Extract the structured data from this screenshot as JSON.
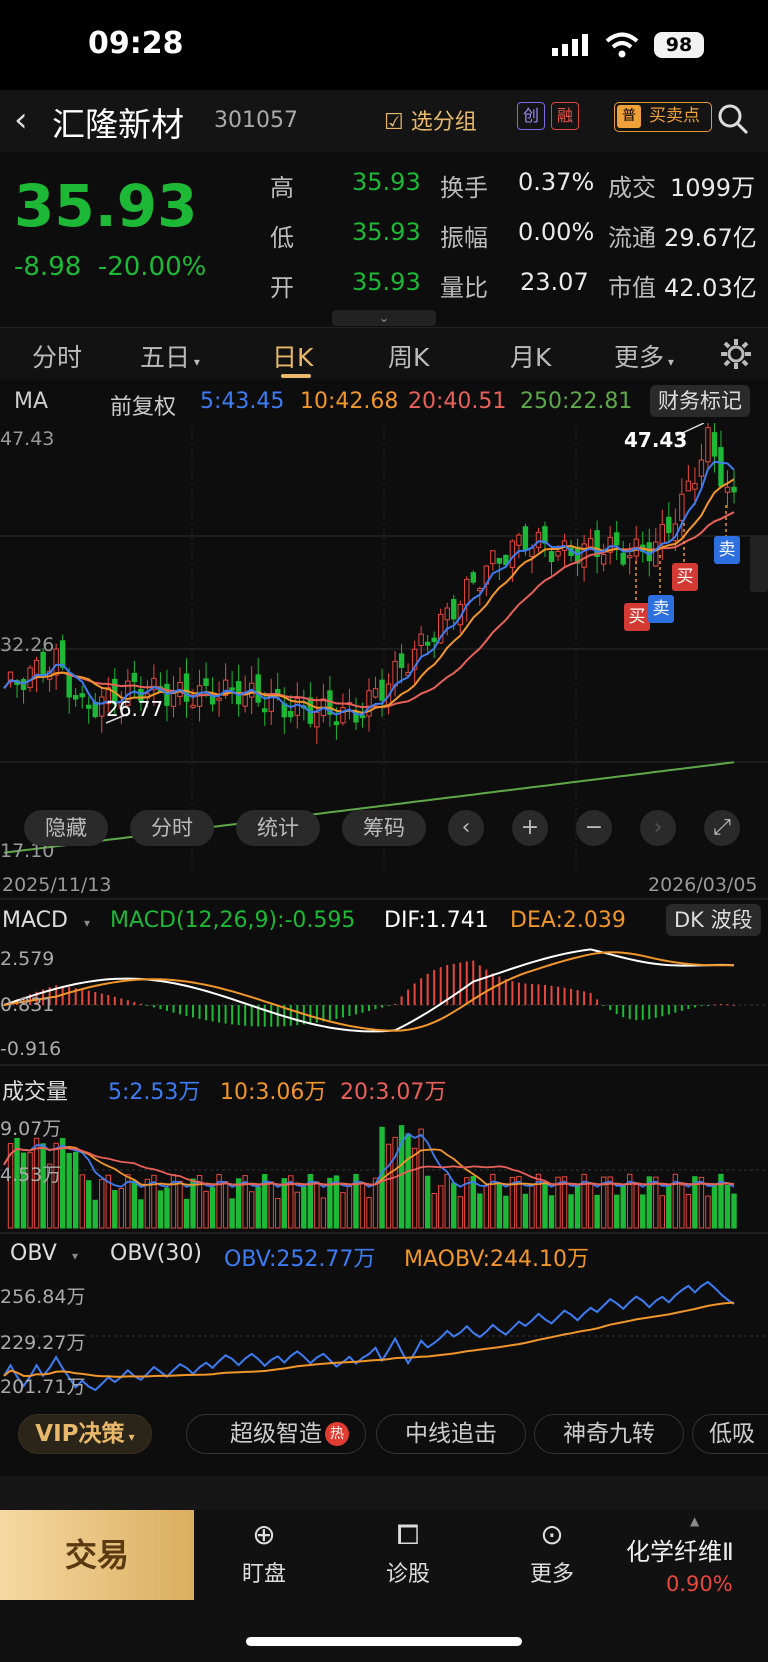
{
  "status": {
    "time": "09:28",
    "battery": "98"
  },
  "header": {
    "name": "汇隆新材",
    "code": "301057",
    "group_btn": "选分组",
    "tag_chuang": "创",
    "tag_rong": "融",
    "tag_pu": "普",
    "buysell_label": "买卖点"
  },
  "quote": {
    "price": "35.93",
    "change": "-8.98",
    "change_pct": "-20.00%",
    "rows": [
      {
        "l1": "高",
        "v1": "35.93",
        "l2": "换手",
        "v2": "0.37%",
        "l3": "成交",
        "v3": "1099万"
      },
      {
        "l1": "低",
        "v1": "35.93",
        "l2": "振幅",
        "v2": "0.00%",
        "l3": "流通",
        "v3": "29.67亿"
      },
      {
        "l1": "开",
        "v1": "35.93",
        "l2": "量比",
        "v2": "23.07",
        "l3": "市值",
        "v3": "42.03亿"
      }
    ]
  },
  "tabs": [
    "分时",
    "五日",
    "日K",
    "周K",
    "月K",
    "更多"
  ],
  "ma": {
    "label": "MA",
    "adj": "前复权",
    "ma5": "5:43.45",
    "ma10": "10:42.68",
    "ma20": "20:40.51",
    "ma250": "250:22.81",
    "fin_mark": "财务标记"
  },
  "kline": {
    "hi_label": "47.43",
    "y_mid_label": "32.26",
    "low_label": "17.10",
    "min_mark": "26.77",
    "max_mark": "47.43",
    "date_start": "2025/11/13",
    "date_end": "2026/03/05",
    "buy": "买",
    "sell": "卖"
  },
  "chart_buttons": [
    "隐藏",
    "分时",
    "统计",
    "筹码"
  ],
  "macd": {
    "label": "MACD",
    "params": "MACD(12,26,9):-0.595",
    "dif": "DIF:1.741",
    "dea": "DEA:2.039",
    "dk": "DK 波段",
    "top": "2.579",
    "mid": "0.831",
    "bottom": "-0.916"
  },
  "vol": {
    "label": "成交量",
    "v5": "5:2.53万",
    "v10": "10:3.06万",
    "v20": "20:3.07万",
    "top": "9.07万",
    "mid": "4.53万"
  },
  "obv": {
    "label": "OBV",
    "params": "OBV(30)",
    "obv": "OBV:252.77万",
    "maobv": "MAOBV:244.10万",
    "top": "256.84万",
    "mid": "229.27万",
    "bottom": "201.71万"
  },
  "vip": {
    "label": "VIP决策",
    "chips": [
      "超级智造",
      "中线追击",
      "神奇九转",
      "低吸"
    ],
    "hot": "热"
  },
  "bottom": {
    "trade": "交易",
    "items": [
      "盯盘",
      "诊股",
      "更多"
    ],
    "sector": "化学纤维Ⅱ",
    "sector_pct": "0.90%"
  },
  "colors": {
    "up": "#e8473d",
    "down": "#1db836",
    "ma5": "#3d7cf2",
    "ma10": "#f0962a",
    "ma20": "#e8605a",
    "ma250": "#5fa84a",
    "gold": "#e8b96a"
  },
  "chart_data": {
    "type": "candlestick",
    "note_range": "2025/11/13 - 2026/03/05",
    "ylim": [
      17.1,
      47.43
    ]
  }
}
